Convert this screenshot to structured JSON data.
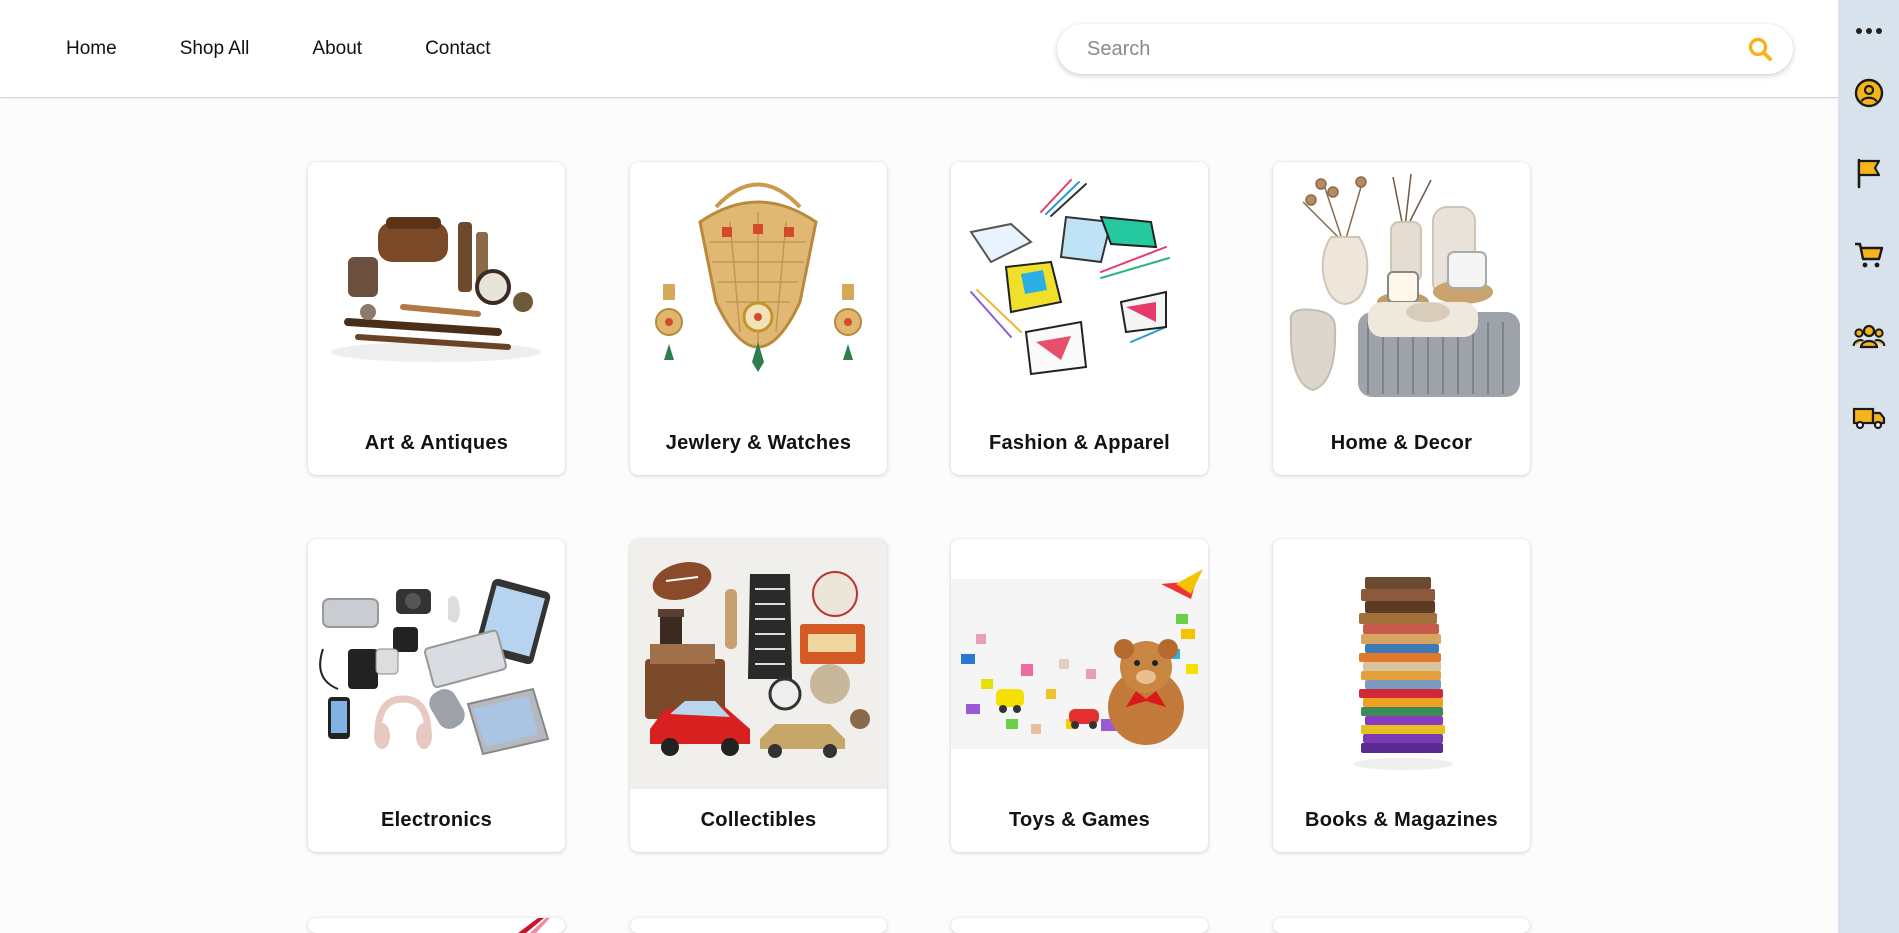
{
  "nav": {
    "items": [
      {
        "label": "Home"
      },
      {
        "label": "Shop All"
      },
      {
        "label": "About"
      },
      {
        "label": "Contact"
      }
    ]
  },
  "search": {
    "placeholder": "Search",
    "value": "",
    "icon": "search-icon"
  },
  "rail": {
    "items": [
      {
        "icon": "more-dots-icon"
      },
      {
        "icon": "user-account-icon"
      },
      {
        "icon": "flag-icon"
      },
      {
        "icon": "shopping-cart-icon"
      },
      {
        "icon": "community-group-icon"
      },
      {
        "icon": "delivery-truck-icon"
      }
    ]
  },
  "categories": [
    {
      "label": "Art & Antiques",
      "image": "antique-tools-image"
    },
    {
      "label": "Jewlery & Watches",
      "image": "gold-necklace-image"
    },
    {
      "label": "Fashion & Apparel",
      "image": "sneakers-image"
    },
    {
      "label": "Home & Decor",
      "image": "vases-blanket-image"
    },
    {
      "label": "Electronics",
      "image": "gadgets-image"
    },
    {
      "label": "Collectibles",
      "image": "vintage-collectibles-image"
    },
    {
      "label": "Toys & Games",
      "image": "teddy-blocks-image"
    },
    {
      "label": "Books & Magazines",
      "image": "book-stack-image"
    }
  ],
  "colors": {
    "accent": "#f5b51a",
    "rail_bg": "#d7e2ec",
    "page_bg": "#fcfcfd"
  }
}
